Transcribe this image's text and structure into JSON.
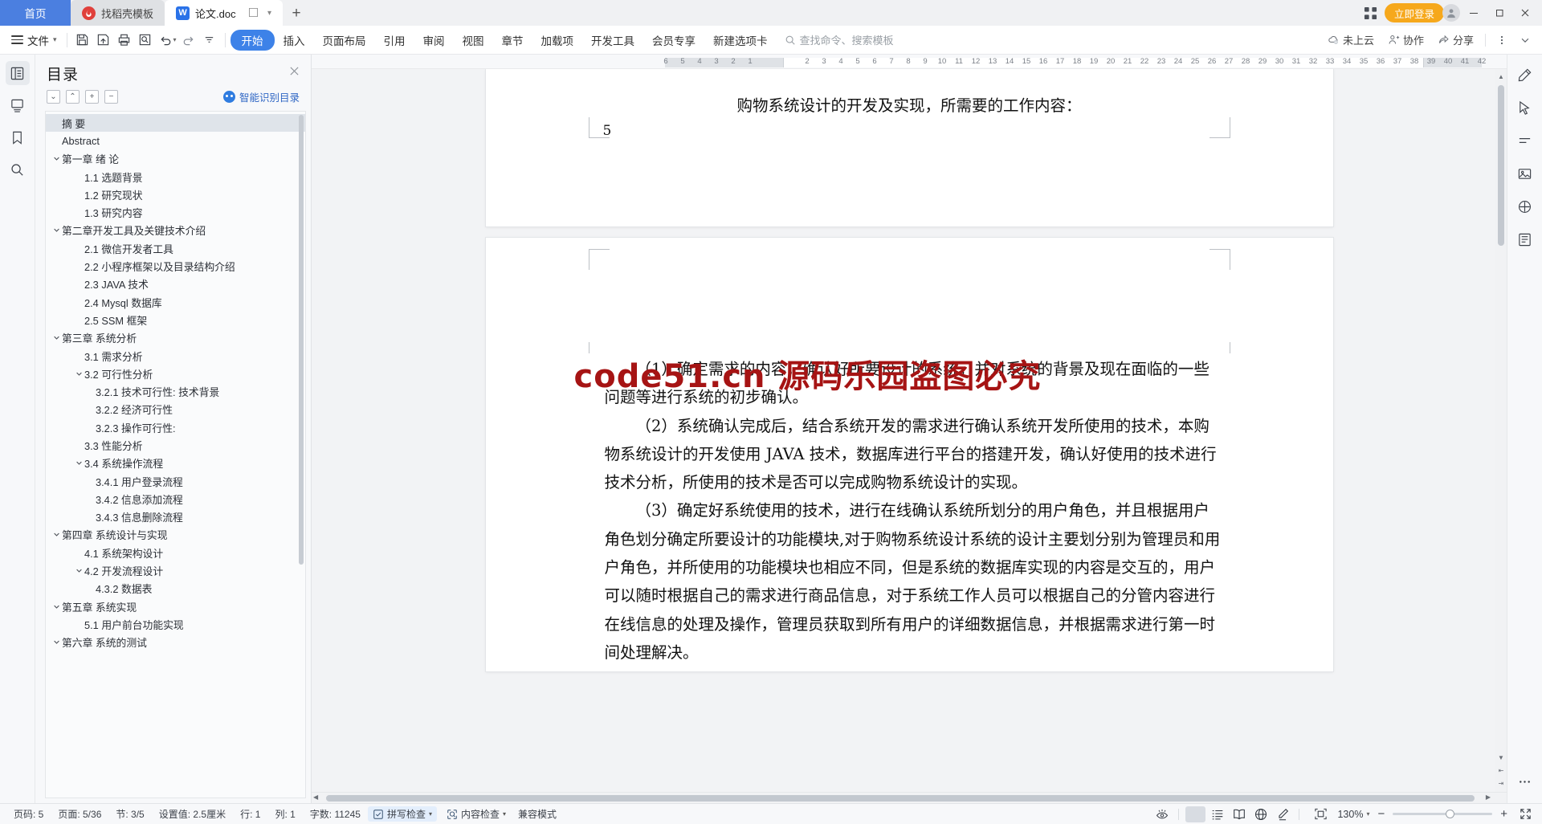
{
  "window": {
    "tabs": [
      {
        "label": "首页",
        "type": "home",
        "icon": "home-tab"
      },
      {
        "label": "找稻壳模板",
        "type": "inactive",
        "icon": "docer-icon"
      },
      {
        "label": "论文.doc",
        "type": "active",
        "icon": "wps-writer-icon"
      }
    ],
    "new_tab_label": "+",
    "login_label": "立即登录",
    "minimize": "–",
    "restore": "❐",
    "close": "✕"
  },
  "ribbon": {
    "file_label": "文件",
    "quick_icons": [
      "save-icon",
      "save-as-icon",
      "print-icon",
      "print-preview-icon",
      "undo-icon",
      "redo-icon",
      "customize-icon"
    ],
    "tabs": [
      {
        "label": "开始",
        "selected": true
      },
      {
        "label": "插入",
        "selected": false
      },
      {
        "label": "页面布局",
        "selected": false
      },
      {
        "label": "引用",
        "selected": false
      },
      {
        "label": "审阅",
        "selected": false
      },
      {
        "label": "视图",
        "selected": false
      },
      {
        "label": "章节",
        "selected": false
      },
      {
        "label": "加载项",
        "selected": false
      },
      {
        "label": "开发工具",
        "selected": false
      },
      {
        "label": "会员专享",
        "selected": false
      },
      {
        "label": "新建选项卡",
        "selected": false
      }
    ],
    "search_placeholder": "查找命令、搜索模板",
    "right_items": [
      {
        "label": "未上云",
        "icon": "cloud-off-icon"
      },
      {
        "label": "协作",
        "icon": "collaborate-icon"
      },
      {
        "label": "分享",
        "icon": "share-icon"
      }
    ],
    "more_icon": "more-vertical-icon",
    "collapse_icon": "chevron-down-icon"
  },
  "left_rail": [
    {
      "icon": "outline-panel-icon",
      "active": true
    },
    {
      "icon": "thumbnail-icon",
      "active": false
    },
    {
      "icon": "bookmark-icon",
      "active": false
    },
    {
      "icon": "search-icon",
      "active": false
    }
  ],
  "right_rail": [
    {
      "icon": "pen-edit-icon"
    },
    {
      "icon": "cursor-select-icon"
    },
    {
      "icon": "paragraph-mark-icon"
    },
    {
      "icon": "picture-icon"
    },
    {
      "icon": "shape-icon"
    },
    {
      "icon": "page-layout-icon"
    },
    {
      "icon": "more-dots-icon"
    }
  ],
  "toc": {
    "title": "目录",
    "close_icon": "close-icon",
    "tools": [
      {
        "icon": "collapse-down-icon",
        "glyph": "⌄"
      },
      {
        "icon": "collapse-up-icon",
        "glyph": "⌃"
      },
      {
        "icon": "expand-all-icon",
        "glyph": "+"
      },
      {
        "icon": "collapse-all-icon",
        "glyph": "−"
      }
    ],
    "smart_label": "智能识别目录",
    "items": [
      {
        "label": "摘  要",
        "level": 0,
        "chevron": "",
        "selected": true
      },
      {
        "label": "Abstract",
        "level": 0,
        "chevron": "",
        "selected": false
      },
      {
        "label": "第一章 绪 论",
        "level": 0,
        "chevron": "down",
        "selected": false
      },
      {
        "label": "1.1 选题背景",
        "level": 1,
        "chevron": "",
        "selected": false
      },
      {
        "label": "1.2 研究现状",
        "level": 1,
        "chevron": "",
        "selected": false
      },
      {
        "label": "1.3 研究内容",
        "level": 1,
        "chevron": "",
        "selected": false
      },
      {
        "label": "第二章开发工具及关键技术介绍",
        "level": 0,
        "chevron": "down",
        "selected": false
      },
      {
        "label": "2.1 微信开发者工具",
        "level": 1,
        "chevron": "",
        "selected": false
      },
      {
        "label": "2.2 小程序框架以及目录结构介绍",
        "level": 1,
        "chevron": "",
        "selected": false
      },
      {
        "label": "2.3 JAVA 技术",
        "level": 1,
        "chevron": "",
        "selected": false
      },
      {
        "label": "2.4   Mysql 数据库",
        "level": 1,
        "chevron": "",
        "selected": false
      },
      {
        "label": "2.5 SSM 框架",
        "level": 1,
        "chevron": "",
        "selected": false
      },
      {
        "label": "第三章 系统分析",
        "level": 0,
        "chevron": "down",
        "selected": false
      },
      {
        "label": "3.1 需求分析",
        "level": 1,
        "chevron": "",
        "selected": false
      },
      {
        "label": "3.2 可行性分析",
        "level": 1,
        "chevron": "down",
        "selected": false
      },
      {
        "label": "3.2.1 技术可行性: 技术背景",
        "level": 2,
        "chevron": "",
        "selected": false
      },
      {
        "label": "3.2.2 经济可行性",
        "level": 2,
        "chevron": "",
        "selected": false
      },
      {
        "label": "3.2.3 操作可行性:",
        "level": 2,
        "chevron": "",
        "selected": false
      },
      {
        "label": "3.3 性能分析",
        "level": 1,
        "chevron": "",
        "selected": false
      },
      {
        "label": "3.4 系统操作流程",
        "level": 1,
        "chevron": "down",
        "selected": false
      },
      {
        "label": "3.4.1 用户登录流程",
        "level": 2,
        "chevron": "",
        "selected": false
      },
      {
        "label": "3.4.2 信息添加流程",
        "level": 2,
        "chevron": "",
        "selected": false
      },
      {
        "label": "3.4.3 信息删除流程",
        "level": 2,
        "chevron": "",
        "selected": false
      },
      {
        "label": "第四章 系统设计与实现",
        "level": 0,
        "chevron": "down",
        "selected": false
      },
      {
        "label": "4.1 系统架构设计",
        "level": 1,
        "chevron": "",
        "selected": false
      },
      {
        "label": "4.2 开发流程设计",
        "level": 1,
        "chevron": "down",
        "selected": false
      },
      {
        "label": "4.3.2 数据表",
        "level": 2,
        "chevron": "",
        "selected": false
      },
      {
        "label": "第五章 系统实现",
        "level": 0,
        "chevron": "down",
        "selected": false
      },
      {
        "label": "5.1 用户前台功能实现",
        "level": 1,
        "chevron": "",
        "selected": false
      },
      {
        "label": "第六章  系统的测试",
        "level": 0,
        "chevron": "down",
        "selected": false
      }
    ]
  },
  "ruler": {
    "left_ticks": [
      "6",
      "5",
      "4",
      "3",
      "2",
      "1"
    ],
    "right_ticks": [
      "2",
      "3",
      "4",
      "5",
      "6",
      "7",
      "8",
      "9",
      "10",
      "11",
      "12",
      "13",
      "14",
      "15",
      "16",
      "17",
      "18",
      "19",
      "20",
      "21",
      "22",
      "23",
      "24",
      "25",
      "26",
      "27",
      "28",
      "29",
      "30",
      "31",
      "32",
      "33",
      "34",
      "35",
      "36",
      "37",
      "38",
      "39",
      "40",
      "41",
      "42"
    ]
  },
  "document": {
    "page1": {
      "heading": "购物系统设计的开发及实现，所需要的工作内容：",
      "page_number": "5"
    },
    "watermark": "code51.cn 源码乐园盗图必究",
    "page2_paragraphs": [
      "（1）确定需求的内容，确认好所要设计的系统，并对系统的背景及现在面临的一些问题等进行系统的初步确认。",
      "（2）系统确认完成后，结合系统开发的需求进行确认系统开发所使用的技术，本购物系统设计的开发使用 JAVA 技术，数据库进行平台的搭建开发，确认好使用的技术进行技术分析，所使用的技术是否可以完成购物系统设计的实现。",
      "（3）确定好系统使用的技术，进行在线确认系统所划分的用户角色，并且根据用户角色划分确定所要设计的功能模块,对于购物系统设计系统的设计主要划分别为管理员和用户角色，并所使用的功能模块也相应不同，但是系统的数据库实现的内容是交互的，用户可以随时根据自己的需求进行商品信息，对于系统工作人员可以根据自己的分管内容进行在线信息的处理及操作，管理员获取到所有用户的详细数据信息，并根据需求进行第一时间处理解决。"
    ]
  },
  "status": {
    "left_items": [
      {
        "label": "页码: 5",
        "name": "page-number"
      },
      {
        "label": "页面: 5/36",
        "name": "page-count"
      },
      {
        "label": "节: 3/5",
        "name": "section"
      },
      {
        "label": "设置值: 2.5厘米",
        "name": "margin-value"
      },
      {
        "label": "行: 1",
        "name": "line"
      },
      {
        "label": "列: 1",
        "name": "column"
      },
      {
        "label": "字数: 11245",
        "name": "word-count"
      }
    ],
    "spell_check": {
      "label": "拼写检查",
      "icon": "spellcheck-icon",
      "caret": "▾"
    },
    "content_check": {
      "label": "内容检查",
      "icon": "content-check-icon",
      "caret": "▾"
    },
    "compat_mode": "兼容模式",
    "view_icons": [
      {
        "icon": "eye-view-icon",
        "active": false
      },
      {
        "icon": "page-view-icon",
        "active": true
      },
      {
        "icon": "outline-view-icon",
        "active": false
      },
      {
        "icon": "read-view-icon",
        "active": false
      },
      {
        "icon": "web-view-icon",
        "active": false
      },
      {
        "icon": "highlight-pen-icon",
        "active": false
      }
    ],
    "fit_icon": "fit-page-icon",
    "zoom_level": "130%",
    "zoom_caret": "▾",
    "zoom_out": "−",
    "zoom_in": "+",
    "fullscreen_icon": "fullscreen-icon"
  },
  "colors": {
    "accent_blue": "#3d82e8",
    "home_tab_blue": "#4b7fe0",
    "login_orange": "#f6a81c",
    "watermark_red": "#a61414",
    "toc_selected": "#dfe4ea"
  }
}
